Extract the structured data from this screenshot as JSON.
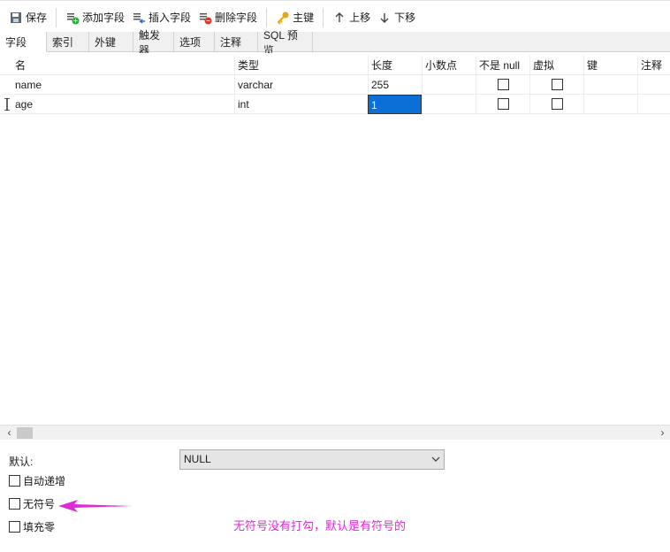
{
  "toolbar": {
    "save": "保存",
    "add_field": "添加字段",
    "insert_field": "插入字段",
    "delete_field": "删除字段",
    "primary_key": "主键",
    "move_up": "上移",
    "move_down": "下移"
  },
  "tabs": [
    "字段",
    "索引",
    "外键",
    "触发器",
    "选项",
    "注释",
    "SQL 预览"
  ],
  "active_tab": "字段",
  "columns": [
    "名",
    "类型",
    "长度",
    "小数点",
    "不是 null",
    "虚拟",
    "键",
    "注释"
  ],
  "rows": [
    {
      "name": "name",
      "type": "varchar",
      "length": "255",
      "not_null": false,
      "virtual": false
    },
    {
      "name": "age",
      "type": "int",
      "length": "1",
      "not_null": false,
      "virtual": false
    }
  ],
  "bottom": {
    "default_label": "默认:",
    "default_value": "NULL",
    "auto_increment": "自动递增",
    "unsigned": "无符号",
    "zerofill": "填充零",
    "annotation": "无符号没有打勾，默认是有符号的"
  },
  "colors": {
    "annotation": "#e02ad8",
    "selection": "#0a6fd6"
  }
}
